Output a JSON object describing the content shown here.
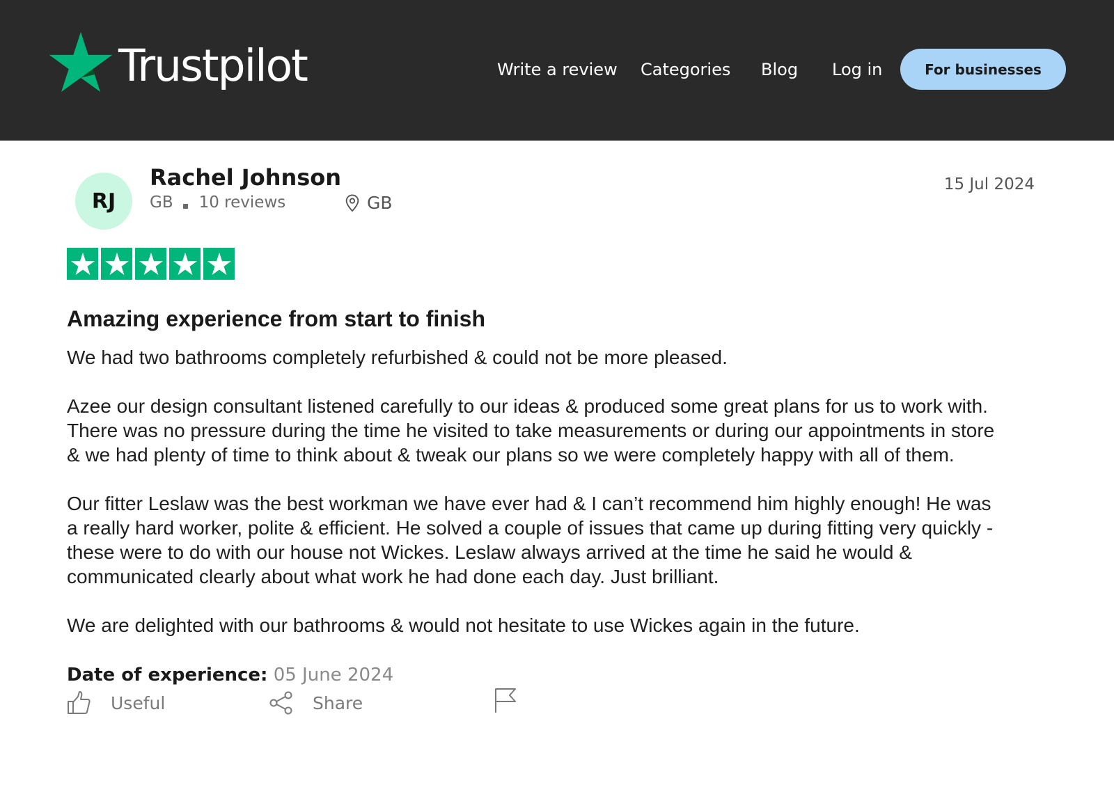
{
  "header": {
    "logo_text": "Trustpilot",
    "nav": {
      "write_review": "Write a review",
      "categories": "Categories",
      "blog": "Blog",
      "login": "Log in"
    },
    "business_button": "For businesses",
    "colors": {
      "background": "#2a2a2a",
      "brand_green": "#00b67a",
      "business_button": "#a9d3f7"
    }
  },
  "review": {
    "author": {
      "initials": "RJ",
      "name": "Rachel Johnson",
      "country": "GB",
      "review_count": "10 reviews",
      "location": "GB",
      "avatar_color": "#c9f7e1"
    },
    "date": "15 Jul 2024",
    "rating": 5,
    "rating_max": 5,
    "title": "Amazing experience from start to finish",
    "paragraphs": [
      [
        "We had two bathrooms completely refurbished & could not be more pleased."
      ],
      [
        "Azee our design consultant listened carefully to our ideas & produced some great plans for us to work with.",
        "There was no pressure during the time he visited to take measurements or during our appointments in store",
        "& we had plenty of time to think about & tweak our plans so we were completely happy with all of them."
      ],
      [
        "Our fitter Leslaw was the best workman we have ever had & I can’t recommend him highly enough! He was",
        "a really hard worker, polite & efficient. He solved a couple of issues that came up during fitting very quickly -",
        "these were to do with our house not Wickes. Leslaw always arrived at the time he said he would &",
        "communicated clearly about what work he had done each day. Just brilliant."
      ],
      [
        "We are delighted with our bathrooms & would not hesitate to use Wickes again in the future."
      ]
    ],
    "date_of_experience_label": "Date of experience:",
    "date_of_experience": "05 June 2024",
    "actions": {
      "useful": "Useful",
      "share": "Share",
      "useful_icon": "thumbs-up-icon",
      "share_icon": "share-icon",
      "report_icon": "flag-icon"
    }
  }
}
